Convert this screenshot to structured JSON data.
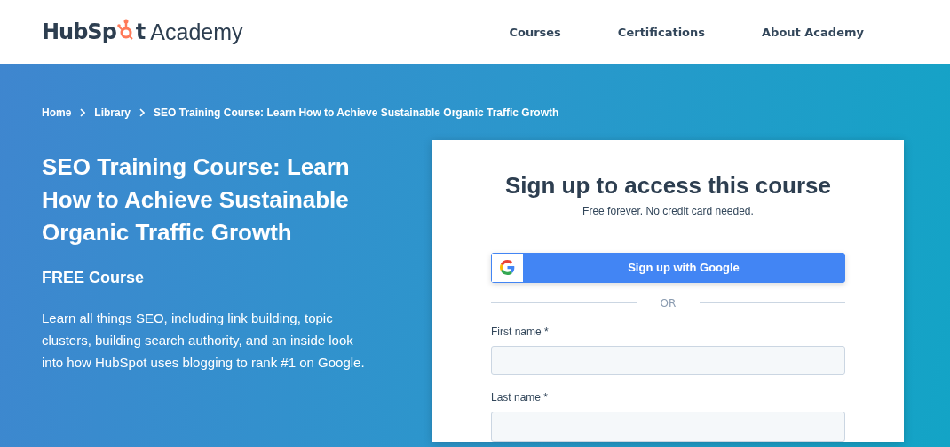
{
  "header": {
    "logo": {
      "brand_start": "HubSp",
      "brand_end": "t",
      "product": "Academy"
    },
    "nav": [
      "Courses",
      "Certifications",
      "About Academy"
    ]
  },
  "breadcrumb": [
    "Home",
    "Library",
    "SEO Training Course: Learn How to Achieve Sustainable Organic Traffic Growth"
  ],
  "course": {
    "title": "SEO Training Course: Learn How to Achieve Sustainable Organic Traffic Growth",
    "badge": "FREE Course",
    "description": "Learn all things SEO, including link building, topic clusters, building search authority, and an inside look into how HubSpot uses blogging to rank #1 on Google."
  },
  "signup": {
    "title": "Sign up to access this course",
    "subtitle": "Free forever. No credit card needed.",
    "google_button": "Sign up with Google",
    "divider": "OR",
    "fields": [
      {
        "label": "First name *"
      },
      {
        "label": "Last name *"
      }
    ]
  }
}
